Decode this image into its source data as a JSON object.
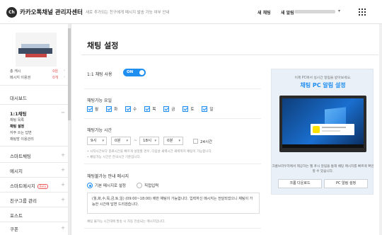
{
  "header": {
    "brand": "카카오톡채널 관리자센터",
    "notice": "새로 추가되는 친구에게 메시지 발송 가능 여부 안내",
    "new_chat": "새 채팅",
    "new_alarm": "새 알림",
    "logo_text": "Ch"
  },
  "sidebar": {
    "stats": [
      {
        "label": "총 캐시",
        "value": "0원"
      },
      {
        "label": "메시지 이용권",
        "value": "0개"
      }
    ],
    "dashboard": "대시보드",
    "chat": {
      "label": "1:1채팅",
      "subs": [
        "채팅 목록",
        "채팅 설정",
        "자주 쓰는 답변",
        "채팅방 이용관리"
      ]
    },
    "items": [
      {
        "label": "스마트채팅"
      },
      {
        "label": "메시지"
      },
      {
        "label": "스마트메시지",
        "badge": "Beta"
      },
      {
        "label": "친구그룹 관리"
      },
      {
        "label": "포스트"
      },
      {
        "label": "쿠폰"
      }
    ]
  },
  "main": {
    "title": "채팅 설정",
    "chat_use": {
      "label": "1:1 채팅 사용",
      "toggle": "ON"
    },
    "days": {
      "label": "채팅가능 요일",
      "list": [
        "월",
        "화",
        "수",
        "목",
        "금",
        "토",
        "일"
      ]
    },
    "time": {
      "label": "채팅가능 시간",
      "start_hour": "9시",
      "start_min": "0분",
      "end_hour": "18시",
      "end_min": "0분",
      "allday": "24시간",
      "hint1": "• 시작시간보다 종료시간을 빠르게 설정할 경우, 다음날 새벽시간 새벽까지 채팅이 가능합니다.",
      "hint2": "• 채팅가능 시간은 한국시간 기준입니다."
    },
    "unavailable": {
      "label": "채팅불가능 안내 메시지",
      "opt_default": "기본 메시지로 설정",
      "opt_custom": "직접입력",
      "message": "(월,화,수,목,금,토,일) (09:00~18:00) 에만 채팅이 가능합니다. 입력하신 메시지는 전달되었으니 채팅이 가능한 시간에 답변 드리겠습니다.",
      "footnote": "채팅 불가능 시간대에 발송 시 자동 전송되는 메시지입니다."
    }
  },
  "promo": {
    "sub": "이제 PC에서 실시간 알림을 받아보세요.",
    "title": "채팅 PC 알림 설정",
    "desc": "크롬브라우저에서 제공하는 웹 푸시 알림을 통해 채팅 메시지를 빠르게 확인할 수 있습니다.",
    "btn_chrome": "크롬 다운로드",
    "btn_pc": "PC 알림 설정"
  }
}
